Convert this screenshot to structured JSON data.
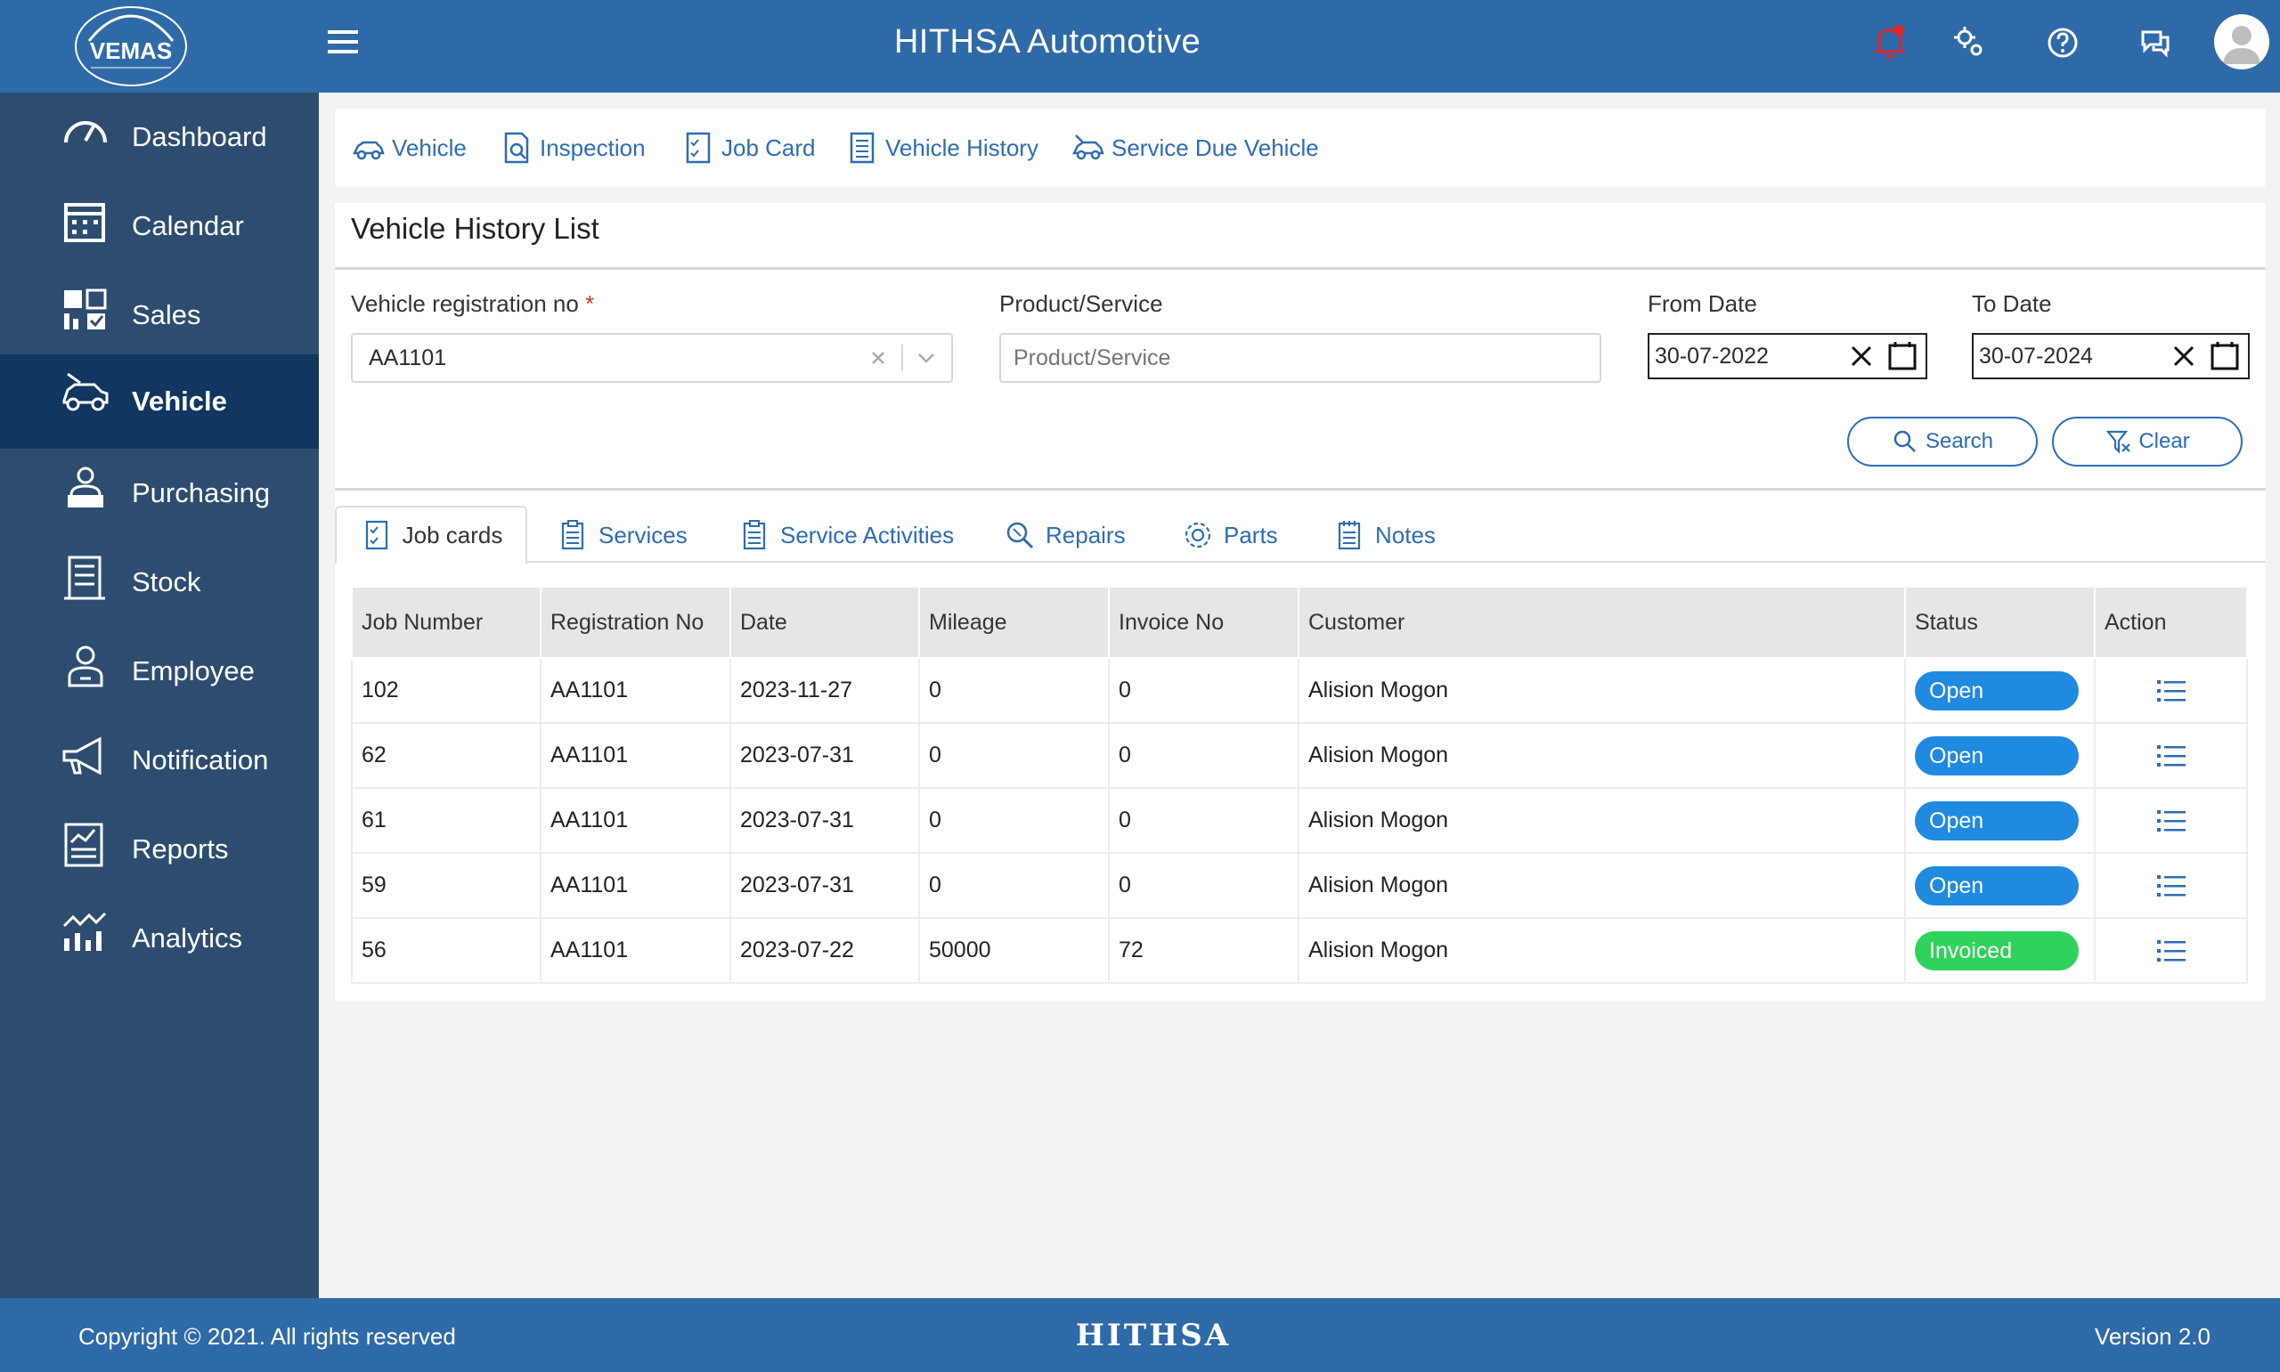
{
  "header": {
    "logo_text": "VEMAS",
    "title": "HITHSA Automotive",
    "icons": [
      "menu-icon",
      "bell-icon",
      "settings-icon",
      "help-icon",
      "chat-icon",
      "user-avatar"
    ]
  },
  "sidebar": {
    "items": [
      {
        "label": "Dashboard",
        "icon": "speedometer-icon",
        "active": false
      },
      {
        "label": "Calendar",
        "icon": "calendar-icon",
        "active": false
      },
      {
        "label": "Sales",
        "icon": "sales-icon",
        "active": false
      },
      {
        "label": "Vehicle",
        "icon": "vehicle-icon",
        "active": true
      },
      {
        "label": "Purchasing",
        "icon": "purchasing-icon",
        "active": false
      },
      {
        "label": "Stock",
        "icon": "stock-icon",
        "active": false
      },
      {
        "label": "Employee",
        "icon": "employee-icon",
        "active": false
      },
      {
        "label": "Notification",
        "icon": "megaphone-icon",
        "active": false
      },
      {
        "label": "Reports",
        "icon": "reports-icon",
        "active": false
      },
      {
        "label": "Analytics",
        "icon": "analytics-icon",
        "active": false
      }
    ]
  },
  "top_tabs": [
    "Vehicle",
    "Inspection",
    "Job Card",
    "Vehicle History",
    "Service Due Vehicle"
  ],
  "page": {
    "title": "Vehicle History List",
    "filters": {
      "reg_label": "Vehicle registration no",
      "reg_required": "*",
      "reg_value": "AA1101",
      "product_label": "Product/Service",
      "product_placeholder": "Product/Service",
      "from_label": "From Date",
      "from_value": "30-07-2022",
      "to_label": "To Date",
      "to_value": "30-07-2024"
    },
    "buttons": {
      "search": "Search",
      "clear": "Clear"
    }
  },
  "result_tabs": [
    "Job cards",
    "Services",
    "Service Activities",
    "Repairs",
    "Parts",
    "Notes"
  ],
  "table": {
    "headers": [
      "Job Number",
      "Registration No",
      "Date",
      "Mileage",
      "Invoice No",
      "Customer",
      "Status",
      "Action"
    ],
    "rows": [
      {
        "job": "102",
        "reg": "AA1101",
        "date": "2023-11-27",
        "mileage": "0",
        "invoice": "0",
        "customer": "Alision Mogon",
        "status": "Open"
      },
      {
        "job": "62",
        "reg": "AA1101",
        "date": "2023-07-31",
        "mileage": "0",
        "invoice": "0",
        "customer": "Alision Mogon",
        "status": "Open"
      },
      {
        "job": "61",
        "reg": "AA1101",
        "date": "2023-07-31",
        "mileage": "0",
        "invoice": "0",
        "customer": "Alision Mogon",
        "status": "Open"
      },
      {
        "job": "59",
        "reg": "AA1101",
        "date": "2023-07-31",
        "mileage": "0",
        "invoice": "0",
        "customer": "Alision Mogon",
        "status": "Open"
      },
      {
        "job": "56",
        "reg": "AA1101",
        "date": "2023-07-22",
        "mileage": "50000",
        "invoice": "72",
        "customer": "Alision Mogon",
        "status": "Invoiced"
      }
    ]
  },
  "footer": {
    "copyright": "Copyright © 2021. All rights reserved",
    "brand": "HITHSA",
    "version": "Version 2.0"
  },
  "colors": {
    "header": "#2f6aa8",
    "sidebar": "#2d4d70",
    "sidebar_active": "#11365f",
    "accent": "#2c6cb5",
    "open": "#1f8ae0",
    "invoiced": "#2fd35c",
    "notification_dot": "#e0252b"
  }
}
